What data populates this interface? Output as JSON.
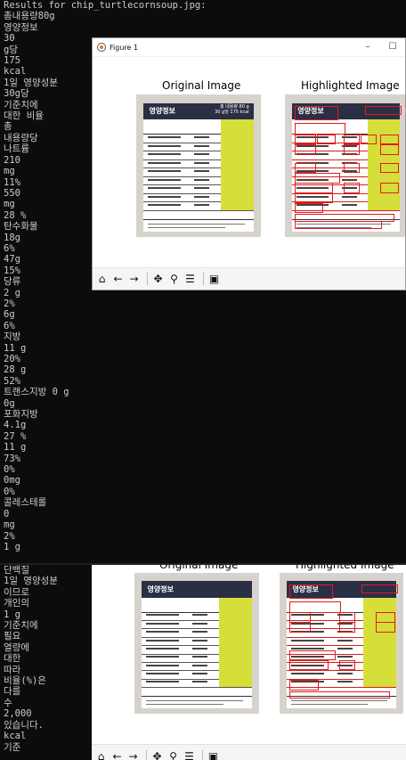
{
  "terminal": {
    "top_lines": [
      "Results for chip_turtlecornsoup.jpg:",
      "총내용량80g",
      "영양정보",
      "30",
      "g당",
      "175",
      "kcal",
      "1일 영양성분",
      "30g당",
      "기준치에",
      "대한 비율",
      "총",
      "내용량당",
      "나트륨",
      "210",
      "mg",
      "11%",
      "550",
      "mg",
      "28 %",
      "탄수화물",
      "18g",
      "6%",
      "47g",
      "15%",
      "당류",
      "2 g",
      "2%",
      "6g",
      "6%",
      "지방",
      "11 g",
      "20%",
      "28 g",
      "52%",
      "트랜스지방 0 g",
      "0g",
      "포화지방",
      "4.1g",
      "27 %",
      "11 g",
      "73%",
      "0%",
      "0mg",
      "0%",
      "콜레스테롤",
      "0",
      "mg",
      "2%",
      "1 g"
    ],
    "bottom_lines": [
      "단백질",
      "1일 영양성분",
      "이므로",
      "개인의",
      "1 g",
      "기준치에",
      "필요",
      "열량에",
      "대한",
      "따라",
      "비율(%)은",
      "다를",
      "수",
      "2,000",
      "있습니다.",
      "kcal",
      "기준"
    ]
  },
  "figure_window": {
    "title": "Figure 1",
    "minimize_glyph": "–",
    "maximize_glyph": "☐",
    "left_panel_title": "Original Image",
    "right_panel_title": "Highlighted Image"
  },
  "nutrition_label": {
    "header_title": "영양정보",
    "header_total": "총 내용량 80 g",
    "header_per": "30 g당 175 kcal"
  },
  "toolbar": {
    "home_glyph": "⌂",
    "back_glyph": "←",
    "forward_glyph": "→",
    "pan_glyph": "✥",
    "zoom_glyph": "⚲",
    "configure_glyph": "☰",
    "save_glyph": "▣"
  }
}
